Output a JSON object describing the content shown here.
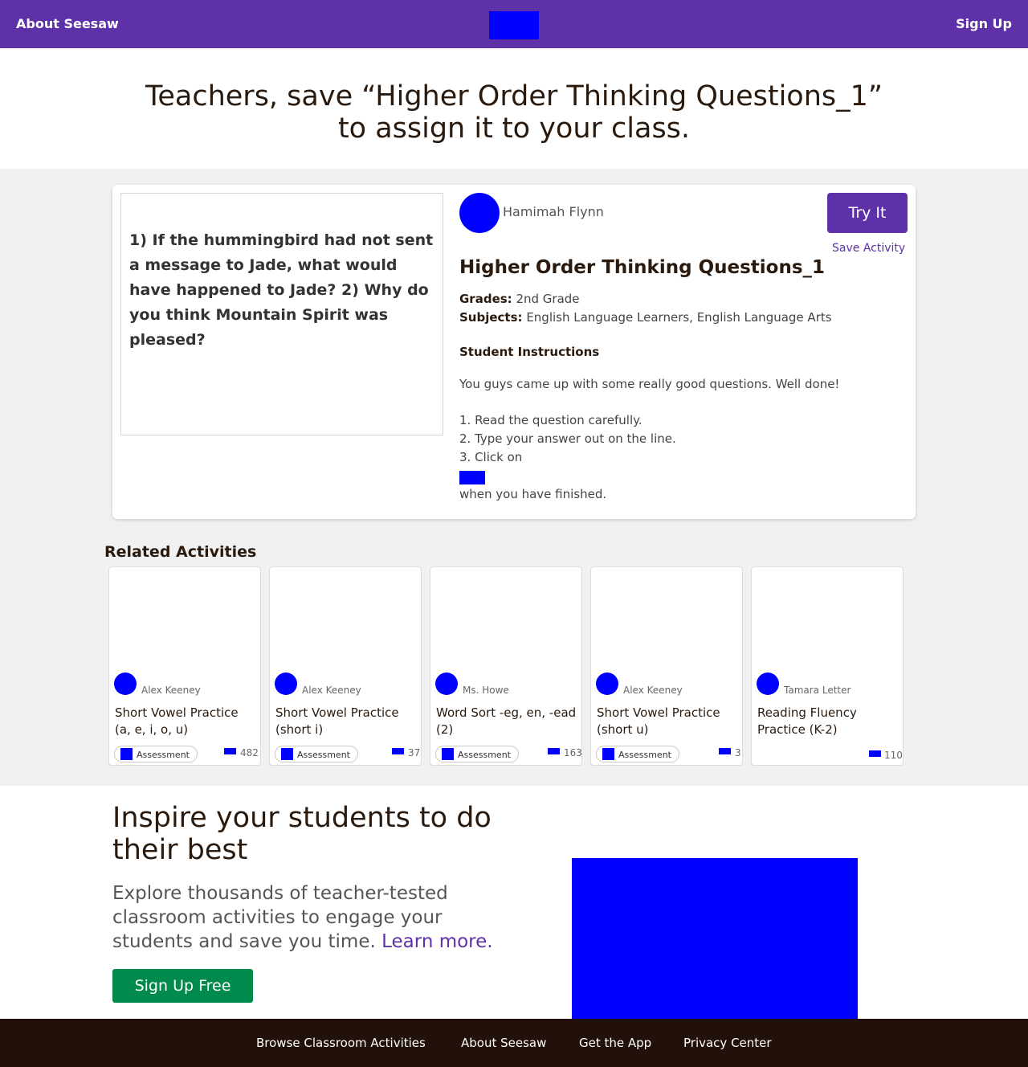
{
  "nav": {
    "left_link": "About Seesaw",
    "right_link": "Sign Up",
    "logo_icon": "seesaw-logo"
  },
  "hero": {
    "heading": "Teachers, save “Higher Order Thinking Questions_1” to assign it to your class."
  },
  "activity": {
    "preview_text": "1) If the hummingbird had not sent a message to Jade, what would have happened to Jade? 2) Why do you think Mountain Spirit was pleased?",
    "author": "Hamimah Flynn",
    "try_label": "Try It",
    "save_label": "Save Activity",
    "title": "Higher Order Thinking Questions_1",
    "grades_label": "Grades:",
    "grades_value": "2nd Grade",
    "subjects_label": "Subjects:",
    "subjects_value": "English Language Learners, English Language Arts",
    "instructions_heading": "Student Instructions",
    "instructions": [
      "You guys came up with some really good questions. Well done!",
      "1. Read the question carefully.",
      "2. Type your answer out on the line.",
      "3. Click on",
      "when you have finished."
    ],
    "check_icon": "check-button-icon"
  },
  "related": {
    "heading": "Related Activities",
    "items": [
      {
        "author": "Alex Keeney",
        "title": "Short Vowel Practice (a, e, i, o, u)",
        "tag": "Assessment",
        "count": "482"
      },
      {
        "author": "Alex Keeney",
        "title": "Short Vowel Practice (short i)",
        "tag": "Assessment",
        "count": "37"
      },
      {
        "author": "Ms. Howe",
        "title": "Word Sort -eg, en, -ead (2)",
        "tag": "Assessment",
        "count": "163"
      },
      {
        "author": "Alex Keeney",
        "title": "Short Vowel Practice (short u)",
        "tag": "Assessment",
        "count": "3"
      },
      {
        "author": "Tamara Letter",
        "title": "Reading Fluency Practice (K-2)",
        "tag": "",
        "count": "110"
      }
    ]
  },
  "promo": {
    "title": "Inspire your students to do their best",
    "text": "Explore thousands of teacher-tested classroom activities to engage your students and save you time.",
    "learn_more": "Learn more.",
    "signup_label": "Sign Up Free"
  },
  "footer": {
    "links": [
      "Browse Classroom Activities",
      "About Seesaw",
      "Get the App",
      "Privacy Center"
    ]
  },
  "colors": {
    "brand_purple": "#5e31a8",
    "cta_green": "#008a4c",
    "footer_dark": "#22100a",
    "band_gray": "#f0f1f3"
  }
}
